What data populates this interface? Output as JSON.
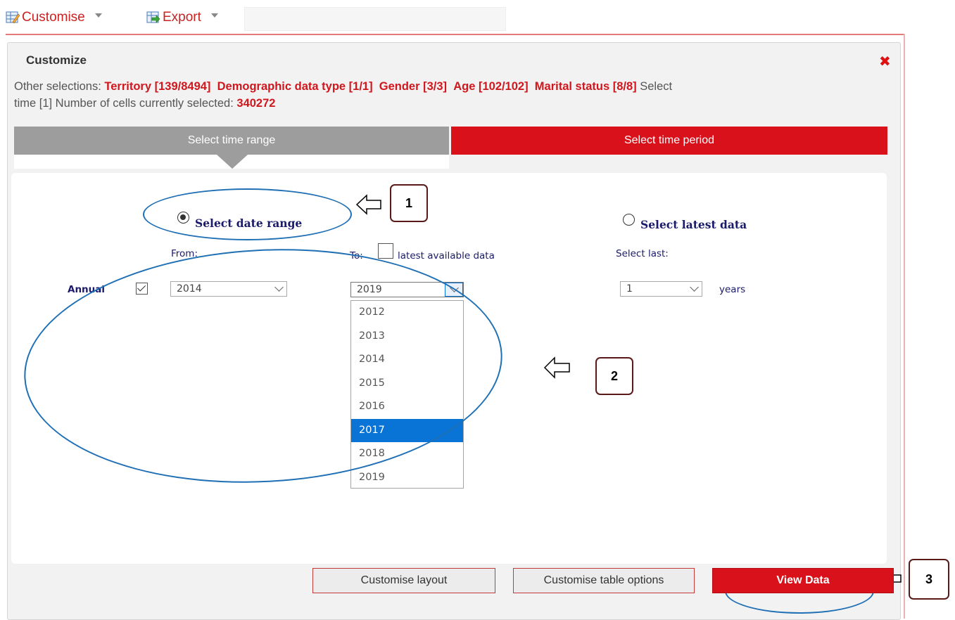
{
  "toolbar": {
    "customise_label": "Customise",
    "export_label": "Export"
  },
  "dialog": {
    "title": "Customize",
    "selections_prefix": "Other selections:",
    "territory": "Territory [139/8494]",
    "demographic": "Demographic data type [1/1]",
    "gender": "Gender [3/3]",
    "age": "Age [102/102]",
    "marital": "Marital status [8/8]",
    "select_word": "Select",
    "time_text": "time [1]  Number of cells currently selected:",
    "cells_count": "340272"
  },
  "tabs": {
    "range": "Select time range",
    "period": "Select time period"
  },
  "range_form": {
    "date_range_label": "Select date range",
    "latest_label": "Select latest data",
    "from_label": "From:",
    "to_label": "To:",
    "latest_available": "latest available data",
    "select_last_label": "Select last:",
    "annual_label": "Annual",
    "from_value": "2014",
    "to_value": "2019",
    "last_value": "1",
    "years_label": "years",
    "to_options": [
      "2012",
      "2013",
      "2014",
      "2015",
      "2016",
      "2017",
      "2018",
      "2019"
    ],
    "to_highlighted": "2017"
  },
  "callouts": {
    "one": "1",
    "two": "2",
    "three": "3"
  },
  "buttons": {
    "customise_layout": "Customise layout",
    "customise_table": "Customise table options",
    "view_data": "View Data"
  }
}
